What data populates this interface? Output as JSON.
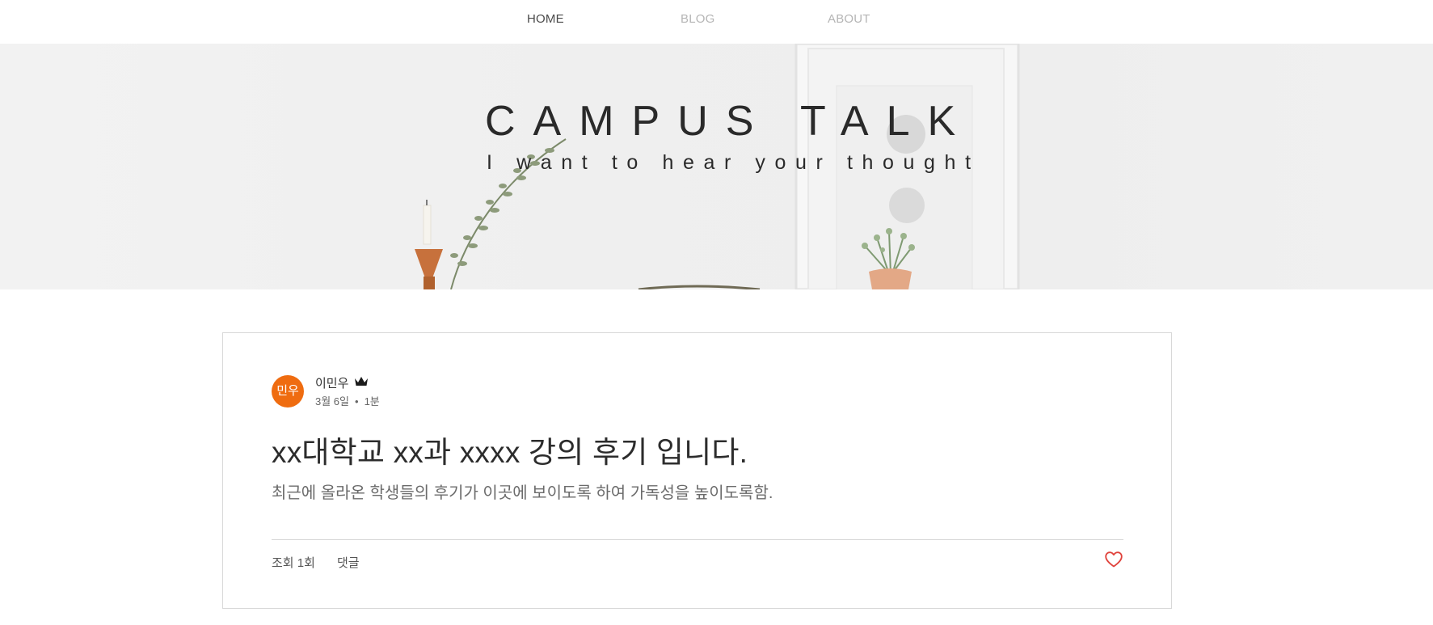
{
  "nav": {
    "items": [
      {
        "label": "HOME",
        "active": true
      },
      {
        "label": "BLOG",
        "active": false
      },
      {
        "label": "ABOUT",
        "active": false
      }
    ]
  },
  "hero": {
    "title": "CAMPUS TALK",
    "subtitle": "I want to hear your thought"
  },
  "post": {
    "author_initials": "민우",
    "author_name": "이민우",
    "author_badge_icon": "crown-icon",
    "date": "3월 6일",
    "read_time": "1분",
    "title": "xx대학교 xx과 xxxx 강의 후기 입니다.",
    "excerpt": "최근에 올라온 학생들의 후기가 이곳에 보이도록 하여 가독성을 높이도록함.",
    "views": "조회 1회",
    "comments": "댓글",
    "like_icon": "heart-icon"
  },
  "colors": {
    "accent": "#ef6c10",
    "like": "#e0433c",
    "nav_active": "#4a4a4a",
    "nav_inactive": "#b5b5b5"
  }
}
